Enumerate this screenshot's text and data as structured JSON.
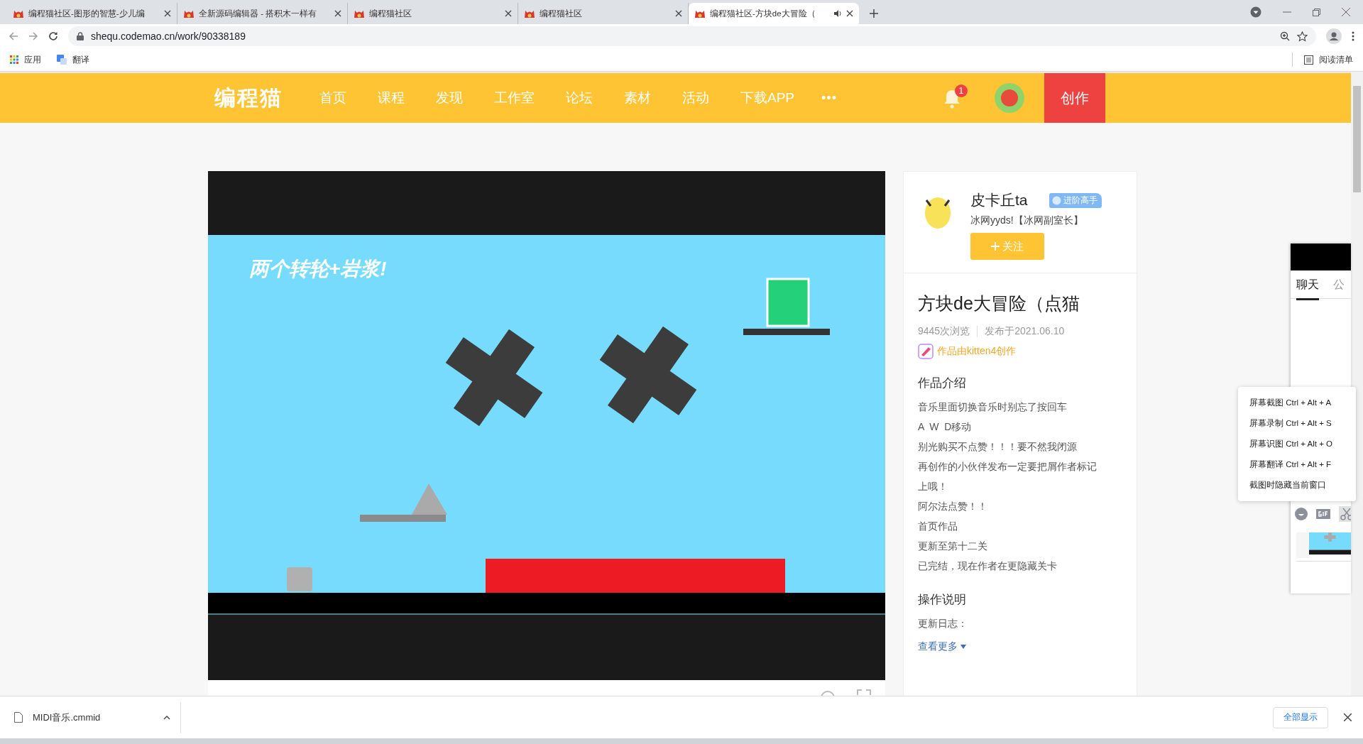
{
  "browser": {
    "tabs": [
      {
        "title": "编程猫社区-图形的智慧-少儿编",
        "selected": false
      },
      {
        "title": "全新源码编辑器 - 搭积木一样有",
        "selected": false
      },
      {
        "title": "编程猫社区",
        "selected": false
      },
      {
        "title": "编程猫社区",
        "selected": false
      },
      {
        "title": "编程猫社区-方块de大冒险（",
        "selected": true
      }
    ],
    "url": "shequ.codemao.cn/work/90338189",
    "bookmarks": [
      "应用",
      "翻译"
    ],
    "reading_list": "阅读清单"
  },
  "site_header": {
    "logo": "编程猫",
    "nav": [
      "首页",
      "课程",
      "发现",
      "工作室",
      "论坛",
      "素材",
      "活动",
      "下载APP"
    ],
    "more": "•••",
    "notification_count": "1",
    "create_button": "创作"
  },
  "game": {
    "caption": "两个转轮+岩浆!"
  },
  "author": {
    "name": "皮卡丘ta",
    "badge": "进阶高手",
    "bio": "冰网yyds!【冰网副室长】",
    "follow_button": "关注"
  },
  "work": {
    "title": "方块de大冒险（点猫",
    "views": "9445次浏览",
    "published": "发布于2021.06.10",
    "made_with": "作品由kitten4创作",
    "intro_heading": "作品介绍",
    "intro_lines": [
      "音乐里面切换音乐时别忘了按回车",
      "A  W  D移动",
      "别光购买不点赞！！！要不然我闭源",
      "再创作的小伙伴发布一定要把屑作者标记",
      "上哦！",
      "阿尔法点赞！！",
      "首页作品",
      "更新至第十二关",
      "已完结，现在作者在更隐藏关卡"
    ],
    "controls_heading": "操作说明",
    "controls_lines": [
      "更新日志："
    ],
    "see_more": "查看更多"
  },
  "chat_panel": {
    "tabs": [
      {
        "label": "聊天",
        "selected": true
      },
      {
        "label": "公",
        "selected": false
      }
    ]
  },
  "screenshot_menu": {
    "items": [
      "屏幕截图 Ctrl + Alt + A",
      "屏幕录制 Ctrl + Alt + S",
      "屏幕识图 Ctrl + Alt + O",
      "屏幕翻译 Ctrl + Alt + F",
      "截图时隐藏当前窗口"
    ]
  },
  "download_bar": {
    "file": "MIDI音乐.cmmid",
    "show_all": "全部显示"
  }
}
